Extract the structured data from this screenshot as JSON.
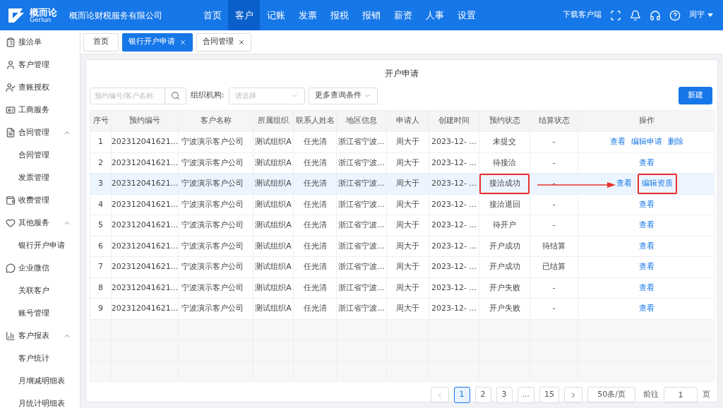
{
  "header": {
    "logo": {
      "name": "概而论",
      "sub": "Gerlun"
    },
    "company": "概而论财税服务有限公司",
    "nav": [
      {
        "label": "首页",
        "selected": false
      },
      {
        "label": "客户",
        "selected": true
      },
      {
        "label": "记账",
        "selected": false
      },
      {
        "label": "发票",
        "selected": false
      },
      {
        "label": "报税",
        "selected": false
      },
      {
        "label": "报销",
        "selected": false
      },
      {
        "label": "薪资",
        "selected": false
      },
      {
        "label": "人事",
        "selected": false
      },
      {
        "label": "设置",
        "selected": false
      }
    ],
    "download": "下载客户端",
    "user": "周宇"
  },
  "sidebar": {
    "items": [
      {
        "label": "接洽单"
      },
      {
        "label": "客户管理"
      },
      {
        "label": "查账授权"
      },
      {
        "label": "工商服务"
      },
      {
        "label": "合同管理",
        "expanded": true,
        "children": [
          {
            "label": "合同管理"
          },
          {
            "label": "发票管理"
          }
        ]
      },
      {
        "label": "收费管理"
      },
      {
        "label": "其他服务",
        "expanded": true,
        "children": [
          {
            "label": "银行开户申请"
          }
        ]
      },
      {
        "label": "企业微信",
        "children": [
          {
            "label": "关联客户"
          },
          {
            "label": "账号管理"
          }
        ]
      },
      {
        "label": "客户报表",
        "expanded": true,
        "children": [
          {
            "label": "客户统计"
          },
          {
            "label": "月增减明细表"
          },
          {
            "label": "月统计明细表"
          }
        ]
      }
    ]
  },
  "tabs": [
    {
      "label": "首页",
      "selected": false,
      "closable": false
    },
    {
      "label": "银行开户申请",
      "selected": true,
      "closable": true
    },
    {
      "label": "合同管理",
      "selected": false,
      "closable": true
    }
  ],
  "page": {
    "title": "开户申请",
    "search": {
      "placeholder": "预约编号/客户名称"
    },
    "org_filter": {
      "label": "组织机构:",
      "placeholder": "请选择"
    },
    "more_filter": "更多查询条件",
    "new_button": "新建",
    "table": {
      "columns": [
        "序号",
        "预约编号",
        "客户名称",
        "所属组织",
        "联系人姓名",
        "地区信息",
        "申请人",
        "创建时间",
        "预约状态",
        "结算状态",
        "操作"
      ],
      "rows": [
        {
          "no": "1",
          "code": "202312041621...",
          "customer": "宁波演示客户公司",
          "org": "测试组织A",
          "contact": "任光清",
          "region": "浙江省宁波...",
          "applicant": "周大于",
          "created": "2023-12- ...",
          "status": "未提交",
          "settle": "-",
          "selected": false,
          "status_marked": false,
          "actions": [
            {
              "label": "查看",
              "marked": false
            },
            {
              "label": "编辑申请",
              "marked": false
            },
            {
              "label": "删除",
              "marked": false
            }
          ]
        },
        {
          "no": "2",
          "code": "202312041621...",
          "customer": "宁波演示客户公司",
          "org": "测试组织A",
          "contact": "任光清",
          "region": "浙江省宁波...",
          "applicant": "周大于",
          "created": "2023-12- ...",
          "status": "待接洽",
          "settle": "-",
          "selected": false,
          "status_marked": false,
          "actions": [
            {
              "label": "查看",
              "marked": false
            }
          ]
        },
        {
          "no": "3",
          "code": "202312041621...",
          "customer": "宁波演示客户公司",
          "org": "测试组织A",
          "contact": "任光清",
          "region": "浙江省宁波...",
          "applicant": "周大于",
          "created": "2023-12- ...",
          "status": "接洽成功",
          "settle": "-",
          "selected": true,
          "status_marked": true,
          "actions": [
            {
              "label": "查看",
              "marked": false
            },
            {
              "label": "编辑资质",
              "marked": true
            }
          ]
        },
        {
          "no": "4",
          "code": "202312041621...",
          "customer": "宁波演示客户公司",
          "org": "测试组织A",
          "contact": "任光清",
          "region": "浙江省宁波...",
          "applicant": "周大于",
          "created": "2023-12- ...",
          "status": "接洽退回",
          "settle": "-",
          "selected": false,
          "status_marked": false,
          "actions": [
            {
              "label": "查看",
              "marked": false
            }
          ]
        },
        {
          "no": "5",
          "code": "202312041621...",
          "customer": "宁波演示客户公司",
          "org": "测试组织A",
          "contact": "任光清",
          "region": "浙江省宁波...",
          "applicant": "周大于",
          "created": "2023-12- ...",
          "status": "待开户",
          "settle": "-",
          "selected": false,
          "status_marked": false,
          "actions": [
            {
              "label": "查看",
              "marked": false
            }
          ]
        },
        {
          "no": "6",
          "code": "202312041621...",
          "customer": "宁波演示客户公司",
          "org": "测试组织A",
          "contact": "任光清",
          "region": "浙江省宁波...",
          "applicant": "周大于",
          "created": "2023-12- ...",
          "status": "开户成功",
          "settle": "待结算",
          "selected": false,
          "status_marked": false,
          "actions": [
            {
              "label": "查看",
              "marked": false
            }
          ]
        },
        {
          "no": "7",
          "code": "202312041621...",
          "customer": "宁波演示客户公司",
          "org": "测试组织A",
          "contact": "任光清",
          "region": "浙江省宁波...",
          "applicant": "周大于",
          "created": "2023-12- ...",
          "status": "开户成功",
          "settle": "已结算",
          "selected": false,
          "status_marked": false,
          "actions": [
            {
              "label": "查看",
              "marked": false
            }
          ]
        },
        {
          "no": "8",
          "code": "202312041621...",
          "customer": "宁波演示客户公司",
          "org": "测试组织A",
          "contact": "任光清",
          "region": "浙江省宁波...",
          "applicant": "周大于",
          "created": "2023-12- ...",
          "status": "开户失败",
          "settle": "-",
          "selected": false,
          "status_marked": false,
          "actions": [
            {
              "label": "查看",
              "marked": false
            }
          ]
        },
        {
          "no": "9",
          "code": "202312041621...",
          "customer": "宁波演示客户公司",
          "org": "测试组织A",
          "contact": "任光清",
          "region": "浙江省宁波...",
          "applicant": "周大于",
          "created": "2023-12- ...",
          "status": "开户失败",
          "settle": "-",
          "selected": false,
          "status_marked": false,
          "actions": [
            {
              "label": "查看",
              "marked": false
            }
          ]
        }
      ]
    },
    "pagination": {
      "pages": [
        {
          "label": "1",
          "selected": true
        },
        {
          "label": "2",
          "selected": false
        },
        {
          "label": "3",
          "selected": false
        },
        {
          "label": "...",
          "selected": false
        },
        {
          "label": "15",
          "selected": false
        }
      ],
      "page_size": "50条/页",
      "goto_label": "前往",
      "goto_value": "1",
      "goto_suffix": "页"
    }
  }
}
